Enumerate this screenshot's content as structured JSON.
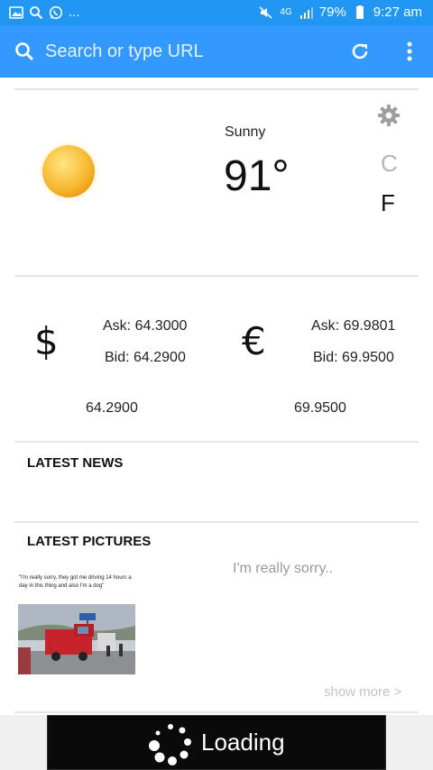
{
  "status_bar": {
    "notification_icons": [
      "gallery-icon",
      "search-icon",
      "whatsapp-icon"
    ],
    "more_indicator": "...",
    "network": "4G",
    "battery": "79%",
    "time": "9:27 am"
  },
  "url_bar": {
    "placeholder": "Search or type URL",
    "icons": [
      "search-icon",
      "refresh-icon",
      "more-vert-icon"
    ]
  },
  "weather": {
    "condition": "Sunny",
    "temperature": "91°",
    "unit_c": "C",
    "unit_f": "F",
    "selected_unit": "F",
    "icons": [
      "sun-icon",
      "gear-icon"
    ]
  },
  "currency": {
    "usd": {
      "symbol": "$",
      "ask": "Ask: 64.3000",
      "bid": "Bid: 64.2900",
      "value": "64.2900"
    },
    "eur": {
      "symbol": "€",
      "ask": "Ask: 69.9801",
      "bid": "Bid: 69.9500",
      "value": "69.9500"
    }
  },
  "news": {
    "title": "LATEST NEWS"
  },
  "pictures": {
    "title": "LATEST PICTURES",
    "caption": "I'm really sorry..",
    "thumbnail_text": "\"I'm really sorry, they got me driving 14 hours a day in this thing and also I'm a dog\"",
    "show_more": "show more >"
  },
  "loading": {
    "text": "Loading"
  },
  "colors": {
    "status_bar": "#2196f3",
    "url_bar": "#3399ff",
    "accent_text": "#111111",
    "muted": "#b5b5b5"
  }
}
